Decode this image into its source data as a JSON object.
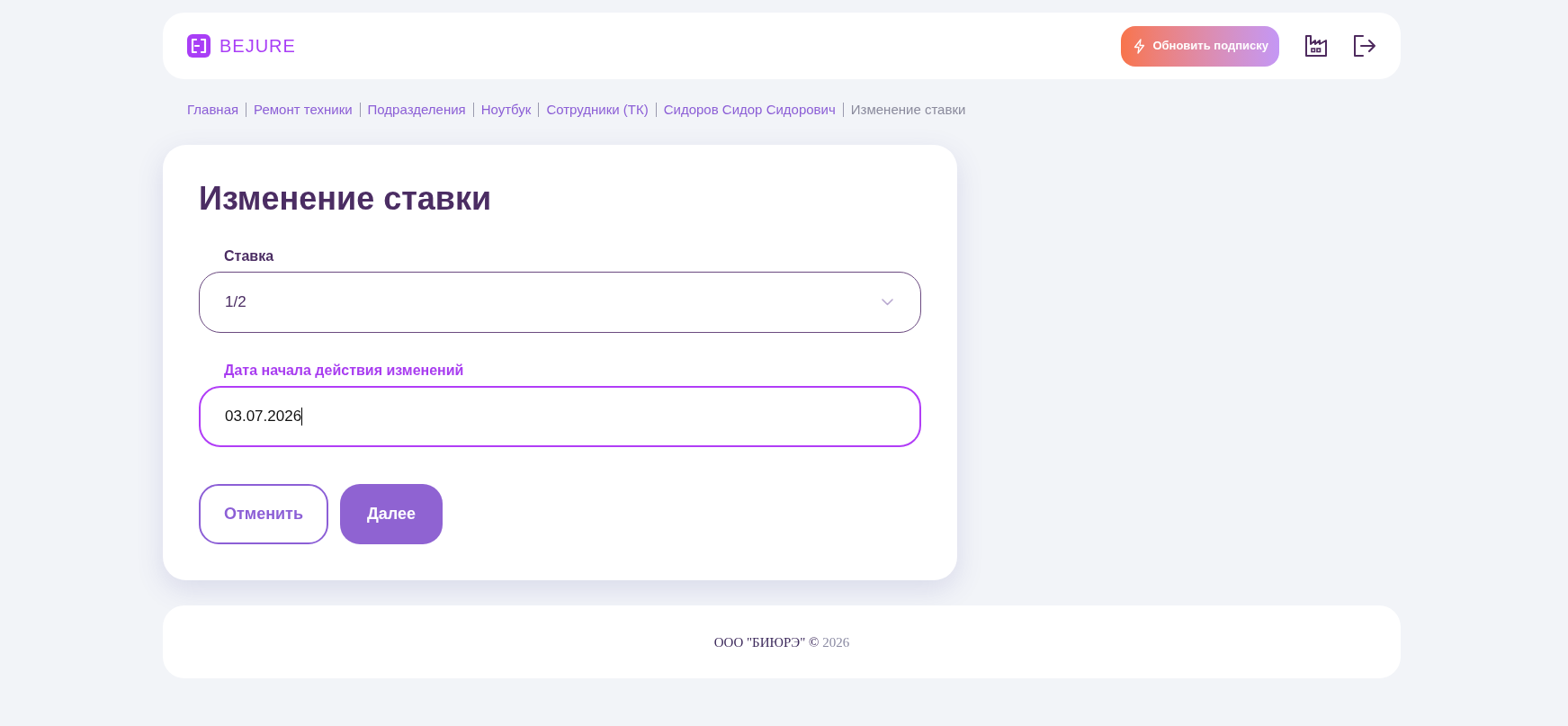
{
  "header": {
    "logo_text": "BEJURE",
    "upgrade_button": "Обновить подписку"
  },
  "breadcrumbs": [
    {
      "label": "Главная",
      "current": false
    },
    {
      "label": "Ремонт техники",
      "current": false
    },
    {
      "label": "Подразделения",
      "current": false
    },
    {
      "label": "Ноутбук",
      "current": false
    },
    {
      "label": "Сотрудники (ТК)",
      "current": false
    },
    {
      "label": "Сидоров Сидор Сидорович",
      "current": false
    },
    {
      "label": "Изменение ставки",
      "current": true
    }
  ],
  "form": {
    "title": "Изменение ставки",
    "fields": [
      {
        "kind": "select",
        "label": "Ставка",
        "value": "1/2",
        "focused": false
      },
      {
        "kind": "date",
        "label": "Дата начала действия изменений",
        "value": "03.07.2026",
        "focused": true
      }
    ],
    "buttons": [
      {
        "kind": "secondary",
        "label": "Отменить"
      },
      {
        "kind": "primary",
        "label": "Далее"
      }
    ]
  },
  "footer": {
    "company": "ООО \"БИЮРЭ\" ©",
    "year": "2026"
  }
}
